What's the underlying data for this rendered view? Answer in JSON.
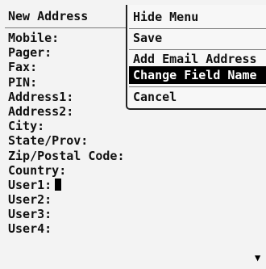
{
  "form": {
    "title": "New Address",
    "fields": [
      "Mobile:",
      "Pager:",
      "Fax:",
      "PIN:",
      "Address1:",
      "Address2:",
      "City:",
      "State/Prov:",
      "Zip/Postal Code:",
      "Country:",
      "User1:",
      "User2:",
      "User3:",
      "User4:"
    ],
    "scroll_indicator": "▼"
  },
  "menu": {
    "items": [
      "Hide Menu",
      "Save",
      "Add Email Address",
      "Change Field Name",
      "Cancel"
    ],
    "selected_index": 3
  }
}
